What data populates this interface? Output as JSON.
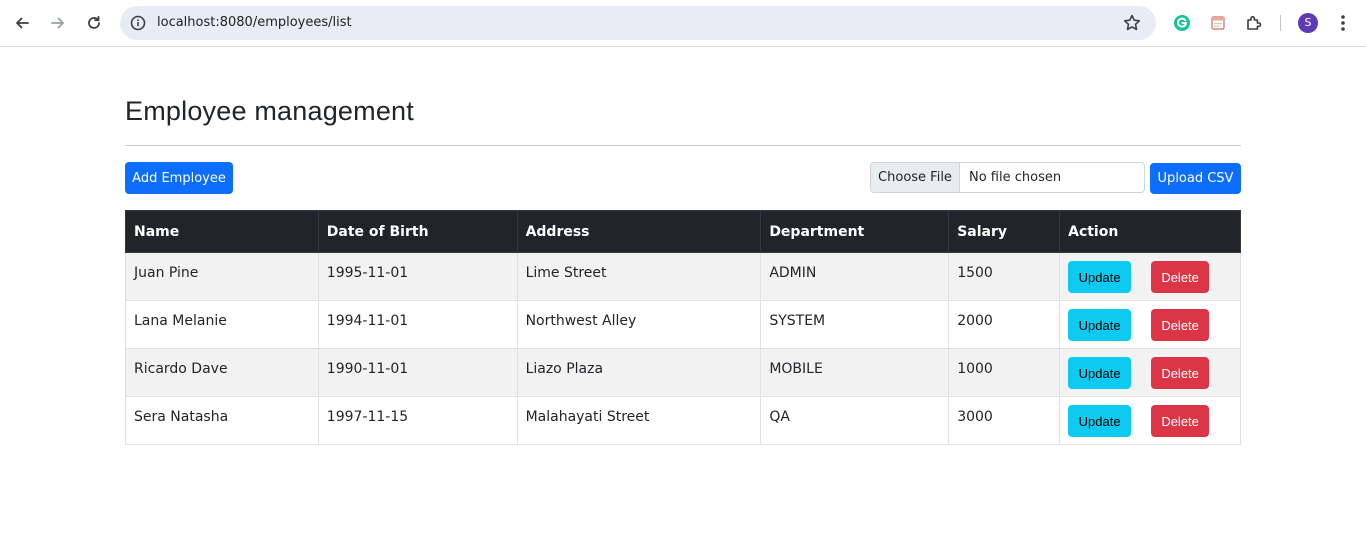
{
  "browser": {
    "url": "localhost:8080/employees/list",
    "profile_initial": "S"
  },
  "page": {
    "title": "Employee management",
    "add_button": "Add Employee",
    "file_input": {
      "button": "Choose File",
      "status": "No file chosen"
    },
    "upload_button": "Upload CSV"
  },
  "table": {
    "headers": [
      "Name",
      "Date of Birth",
      "Address",
      "Department",
      "Salary",
      "Action"
    ],
    "rows": [
      [
        "Juan Pine",
        "1995-11-01",
        "Lime Street",
        "ADMIN",
        "1500"
      ],
      [
        "Lana Melanie",
        "1994-11-01",
        "Northwest Alley",
        "SYSTEM",
        "2000"
      ],
      [
        "Ricardo Dave",
        "1990-11-01",
        "Liazo Plaza",
        "MOBILE",
        "1000"
      ],
      [
        "Sera Natasha",
        "1997-11-15",
        "Malahayati Street",
        "QA",
        "3000"
      ]
    ],
    "update_label": "Update",
    "delete_label": "Delete"
  },
  "colors": {
    "primary": "#0d6efd",
    "info": "#0dcaf0",
    "danger": "#dc3545",
    "header_dark": "#212529"
  },
  "icons": [
    "back-arrow-icon",
    "forward-arrow-icon",
    "reload-icon",
    "info-icon",
    "star-icon",
    "grammarly-icon",
    "bookmark-extension-icon",
    "extensions-puzzle-icon",
    "more-vert-icon"
  ]
}
